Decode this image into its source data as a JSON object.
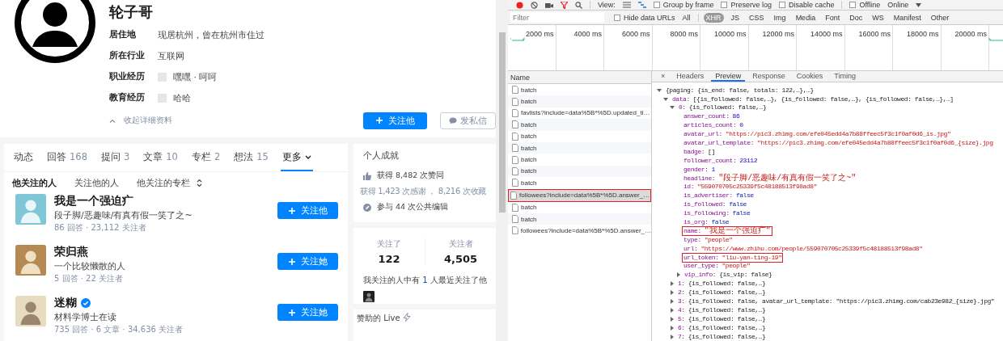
{
  "profile": {
    "name": "轮子哥",
    "details": [
      {
        "label": "居住地",
        "value": "现居杭州，曾在杭州市住过",
        "logo": false
      },
      {
        "label": "所在行业",
        "value": "互联网",
        "logo": false
      },
      {
        "label": "职业经历",
        "value": "嘿嘿 · 呵呵",
        "logo": true
      },
      {
        "label": "教育经历",
        "value": "哈哈",
        "logo": true
      }
    ],
    "collapse": "收起详细资料",
    "follow_button": "关注他",
    "message_button": "发私信"
  },
  "tabs": [
    {
      "label": "动态",
      "selected": false,
      "dropdown": false
    },
    {
      "label": "回答",
      "count": "168",
      "selected": false,
      "dropdown": false
    },
    {
      "label": "提问",
      "count": "3",
      "selected": false,
      "dropdown": false
    },
    {
      "label": "文章",
      "count": "10",
      "selected": false,
      "dropdown": false
    },
    {
      "label": "专栏",
      "count": "2",
      "selected": false,
      "dropdown": false
    },
    {
      "label": "想法",
      "count": "15",
      "selected": false,
      "dropdown": false
    },
    {
      "label": "更多",
      "selected": true,
      "dropdown": true
    }
  ],
  "subtabs": [
    {
      "label": "他关注的人",
      "selected": true,
      "sort": false
    },
    {
      "label": "关注他的人",
      "selected": false,
      "sort": false
    },
    {
      "label": "他关注的专栏",
      "selected": false,
      "sort": true
    }
  ],
  "people": [
    {
      "name": "我是一个强迫疒",
      "verified": false,
      "headline": "段子脚/恶趣味/有真有假一笑了之~",
      "stats": "86 回答 · 23,112 关注者",
      "button": "关注他"
    },
    {
      "name": "荣归燕",
      "verified": false,
      "headline": "一个比较懒散的人",
      "stats": "5 回答 · 22 关注者",
      "button": "关注她"
    },
    {
      "name": "迷糊",
      "verified": true,
      "headline": "材料学博士在读",
      "stats": "735 回答 · 6 文章 · 34,636 关注者",
      "button": "关注她"
    }
  ],
  "achievements": {
    "title": "个人成就",
    "items": [
      {
        "kind": "like",
        "text": "获得 8,482 次赞同"
      },
      {
        "kind": "sub",
        "text": "获得 1,423 次感谢 ， 8,216 次收藏"
      },
      {
        "kind": "edit",
        "text": "参与 44 次公共编辑"
      }
    ]
  },
  "follow_stats": [
    {
      "label": "关注了",
      "value": "122"
    },
    {
      "label": "关注者",
      "value": "4,505"
    }
  ],
  "mutual": {
    "before": "我关注的人中有",
    "count": "1",
    "after": "人最近关注了他"
  },
  "live": {
    "title": "赞助的 Live"
  },
  "devtools": {
    "toolbar": {
      "view_label": "View:",
      "checkboxes": [
        {
          "label": "Group by frame",
          "checked": false
        },
        {
          "label": "Preserve log",
          "checked": false
        },
        {
          "label": "Disable cache",
          "checked": false
        },
        {
          "label": "Offline",
          "checked": false
        }
      ],
      "throttle": "Online"
    },
    "filter": {
      "placeholder": "Filter",
      "hide_data_urls": {
        "label": "Hide data URLs",
        "checked": false
      },
      "types": [
        {
          "label": "All",
          "selected": false
        },
        {
          "label": "XHR",
          "selected": true
        },
        {
          "label": "JS",
          "selected": false
        },
        {
          "label": "CSS",
          "selected": false
        },
        {
          "label": "Img",
          "selected": false
        },
        {
          "label": "Media",
          "selected": false
        },
        {
          "label": "Font",
          "selected": false
        },
        {
          "label": "Doc",
          "selected": false
        },
        {
          "label": "WS",
          "selected": false
        },
        {
          "label": "Manifest",
          "selected": false
        },
        {
          "label": "Other",
          "selected": false
        }
      ]
    },
    "timeline": {
      "ticks": [
        "2000 ms",
        "4000 ms",
        "6000 ms",
        "8000 ms",
        "10000 ms",
        "12000 ms",
        "14000 ms",
        "16000 ms",
        "18000 ms",
        "20000 ms"
      ]
    },
    "requests": {
      "header": "Name",
      "items": [
        {
          "name": "batch",
          "selected": false,
          "boxed": false
        },
        {
          "name": "batch",
          "selected": false,
          "boxed": false
        },
        {
          "name": "favlists?include=data%5B*%5D.updated_ti…",
          "selected": false,
          "boxed": false
        },
        {
          "name": "batch",
          "selected": false,
          "boxed": false
        },
        {
          "name": "batch",
          "selected": false,
          "boxed": false
        },
        {
          "name": "batch",
          "selected": false,
          "boxed": false
        },
        {
          "name": "batch",
          "selected": false,
          "boxed": false
        },
        {
          "name": "batch",
          "selected": false,
          "boxed": false
        },
        {
          "name": "batch",
          "selected": false,
          "boxed": false
        },
        {
          "name": "followees?include=data%5B*%5D.answer_…",
          "selected": true,
          "boxed": true
        },
        {
          "name": "batch",
          "selected": false,
          "boxed": false
        },
        {
          "name": "batch",
          "selected": false,
          "boxed": false
        },
        {
          "name": "followees?include=data%5B*%5D.answer_…",
          "selected": false,
          "boxed": false
        }
      ]
    },
    "preview": {
      "close": "×",
      "tabs": [
        {
          "label": "Headers",
          "selected": false
        },
        {
          "label": "Preview",
          "selected": true
        },
        {
          "label": "Response",
          "selected": false
        },
        {
          "label": "Cookies",
          "selected": false
        },
        {
          "label": "Timing",
          "selected": false
        }
      ],
      "tree": [
        {
          "kind": "object",
          "value": "{paging: {is_end: false, totals: 122,…},…}",
          "expanded": true,
          "children": [
            {
              "kind": "object",
              "key": "data:",
              "value": "[{is_followed: false,…}, {is_followed: false,…}, {is_followed: false,…},…]",
              "expanded": true,
              "children": [
                {
                  "kind": "object",
                  "key": "0:",
                  "value": "{is_followed: false,…}",
                  "expanded": true,
                  "children": [
                    {
                      "kind": "number",
                      "key": "answer_count:",
                      "value": "86",
                      "boxed": false
                    },
                    {
                      "kind": "number",
                      "key": "articles_count:",
                      "value": "0",
                      "boxed": false
                    },
                    {
                      "kind": "string",
                      "key": "avatar_url:",
                      "value": "\"https://pic3.zhimg.com/efe045edd4a7b88ffeec5f3c1f0af0d6_is.jpg\"",
                      "boxed": false
                    },
                    {
                      "kind": "string",
                      "key": "avatar_url_template:",
                      "value": "\"https://pic3.zhimg.com/efe045edd4a7b88ffeec5f3c1f0af0d6_{size}.jpg",
                      "boxed": false
                    },
                    {
                      "kind": "array",
                      "key": "badge:",
                      "value": "[]",
                      "boxed": false
                    },
                    {
                      "kind": "number",
                      "key": "follower_count:",
                      "value": "23112",
                      "boxed": false
                    },
                    {
                      "kind": "number",
                      "key": "gender:",
                      "value": "1",
                      "boxed": false
                    },
                    {
                      "kind": "text",
                      "key": "headline:",
                      "value": "\"段子脚/恶趣味/有真有假一笑了之~\"",
                      "boxed": false
                    },
                    {
                      "kind": "string",
                      "key": "id:",
                      "value": "\"559070705c25339f5c48188513f98ad8\"",
                      "boxed": false
                    },
                    {
                      "kind": "bool",
                      "key": "is_advertiser:",
                      "value": "false",
                      "boxed": false
                    },
                    {
                      "kind": "bool",
                      "key": "is_followed:",
                      "value": "false",
                      "boxed": false
                    },
                    {
                      "kind": "bool",
                      "key": "is_following:",
                      "value": "false",
                      "boxed": false
                    },
                    {
                      "kind": "bool",
                      "key": "is_org:",
                      "value": "false",
                      "boxed": false
                    },
                    {
                      "kind": "text",
                      "key": "name:",
                      "value": "\"我是一个强迫疒\"",
                      "boxed": true
                    },
                    {
                      "kind": "string",
                      "key": "type:",
                      "value": "\"people\"",
                      "boxed": false
                    },
                    {
                      "kind": "string",
                      "key": "url:",
                      "value": "\"https://www.zhihu.com/people/559070705c25339f5c48188513f98ad8\"",
                      "boxed": false
                    },
                    {
                      "kind": "string",
                      "key": "url_token:",
                      "value": "\"liu-yan-ting-19\"",
                      "boxed": true
                    },
                    {
                      "kind": "string",
                      "key": "user_type:",
                      "value": "\"people\"",
                      "boxed": false
                    },
                    {
                      "kind": "object",
                      "key": "vip_info:",
                      "value": "{is_vip: false}",
                      "expanded": false
                    }
                  ]
                },
                {
                  "kind": "object",
                  "key": "1:",
                  "value": "{is_followed: false,…}",
                  "expanded": false
                },
                {
                  "kind": "object",
                  "key": "2:",
                  "value": "{is_followed: false,…}",
                  "expanded": false
                },
                {
                  "kind": "object",
                  "key": "3:",
                  "value": "{is_followed: false, avatar_url_template: \"https://pic3.zhimg.com/cab23e982_{size}.jpg\"",
                  "expanded": false
                },
                {
                  "kind": "object",
                  "key": "4:",
                  "value": "{is_followed: false,…}",
                  "expanded": false
                },
                {
                  "kind": "object",
                  "key": "5:",
                  "value": "{is_followed: false,…}",
                  "expanded": false
                },
                {
                  "kind": "object",
                  "key": "6:",
                  "value": "{is_followed: false,…}",
                  "expanded": false
                },
                {
                  "kind": "object",
                  "key": "7:",
                  "value": "{is_followed: false,…}",
                  "expanded": false
                }
              ]
            }
          ]
        }
      ]
    }
  }
}
